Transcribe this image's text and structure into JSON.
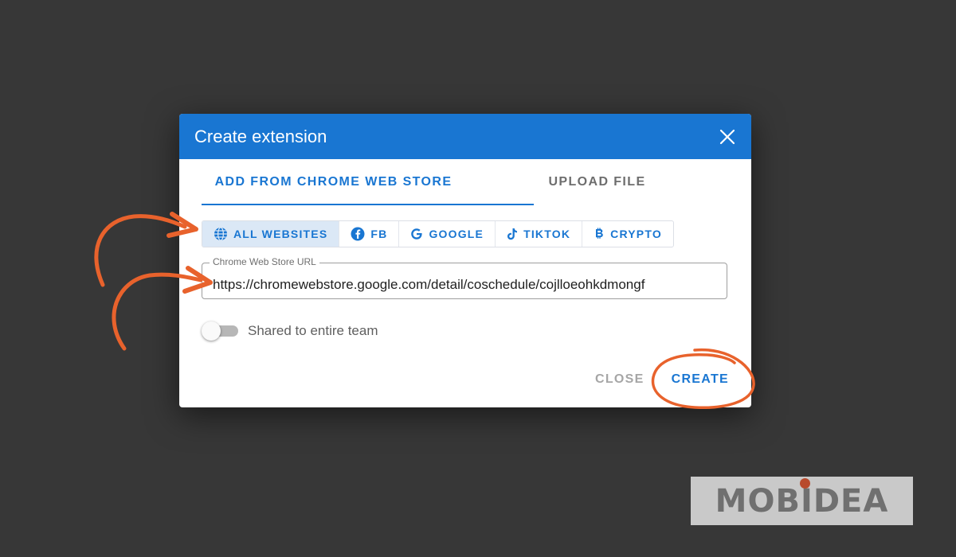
{
  "dialog": {
    "title": "Create extension",
    "close_icon": "close-icon"
  },
  "tabs": [
    {
      "label": "ADD FROM CHROME WEB STORE",
      "active": true
    },
    {
      "label": "UPLOAD FILE",
      "active": false
    }
  ],
  "filters": [
    {
      "label": "ALL WEBSITES",
      "icon": "globe-icon",
      "active": true
    },
    {
      "label": "FB",
      "icon": "facebook-icon",
      "active": false
    },
    {
      "label": "GOOGLE",
      "icon": "google-icon",
      "active": false
    },
    {
      "label": "TIKTOK",
      "icon": "tiktok-icon",
      "active": false
    },
    {
      "label": "CRYPTO",
      "icon": "bitcoin-icon",
      "active": false
    }
  ],
  "url_field": {
    "label": "Chrome Web Store URL",
    "value": "https://chromewebstore.google.com/detail/coschedule/cojlloeohkdmongf"
  },
  "shared_toggle": {
    "label": "Shared to entire team",
    "on": false
  },
  "actions": {
    "close_label": "CLOSE",
    "create_label": "CREATE"
  },
  "watermark": {
    "text": "MOBIDEA"
  },
  "colors": {
    "primary": "#1976d2",
    "background": "#373737",
    "annotation": "#e8622c"
  }
}
